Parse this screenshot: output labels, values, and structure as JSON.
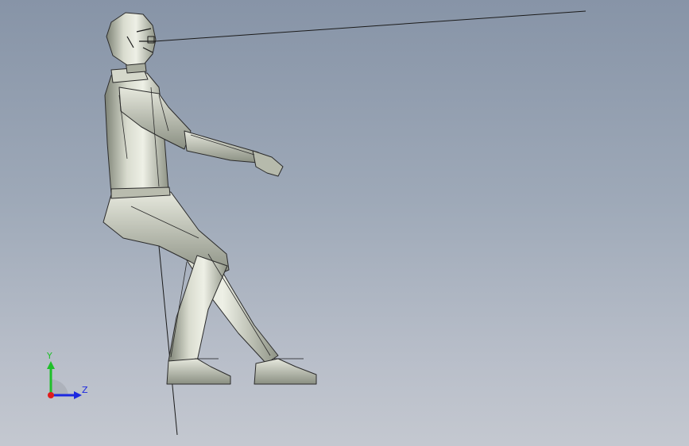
{
  "triad": {
    "y_label": "Y",
    "z_label": "Z",
    "colors": {
      "y": "#1fbf2a",
      "z": "#1c28e0",
      "x": "#e01c1c"
    }
  },
  "model": {
    "shell_color": "#c9ccbd",
    "shade_color": "#8f9486",
    "edge_color": "#1a1a1a"
  }
}
